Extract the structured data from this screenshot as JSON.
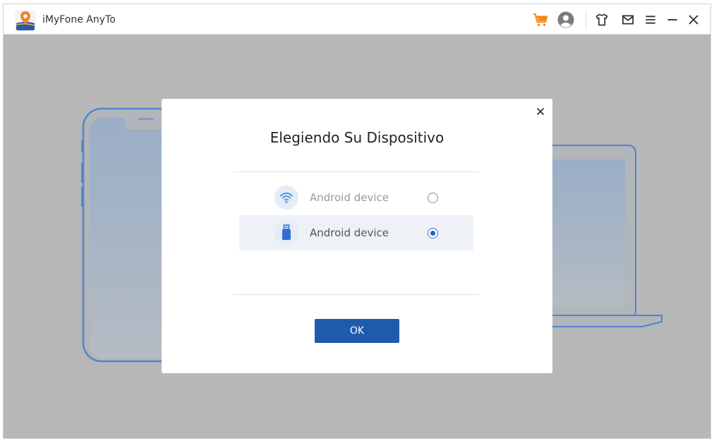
{
  "app": {
    "title": "iMyFone AnyTo",
    "accent_color": "#1f5bab",
    "cart_color": "#f08a1c"
  },
  "toolbar": {
    "icons": [
      "cart-icon",
      "user-icon",
      "tshirt-icon",
      "mail-icon",
      "menu-icon",
      "minimize-icon",
      "close-icon"
    ]
  },
  "dialog": {
    "title": "Elegiendo Su Dispositivo",
    "options": [
      {
        "label": "Android device",
        "icon": "wifi-icon",
        "selected": false
      },
      {
        "label": "Android device",
        "icon": "usb-icon",
        "selected": true
      }
    ],
    "ok_label": "OK"
  }
}
